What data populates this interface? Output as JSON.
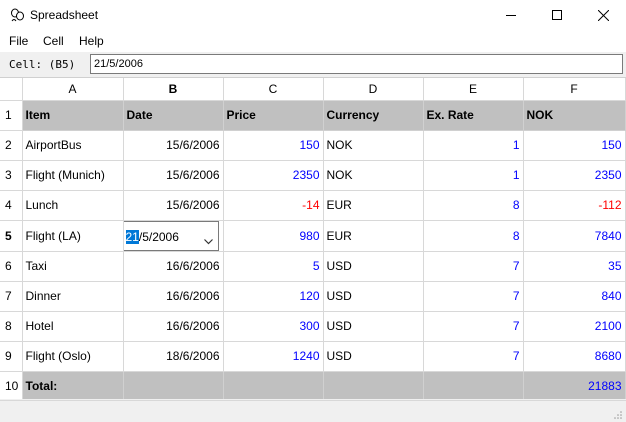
{
  "window": {
    "title": "Spreadsheet"
  },
  "menu": [
    "File",
    "Cell",
    "Help"
  ],
  "formula": {
    "cell_label": "Cell: (B5)",
    "value": "21/5/2006"
  },
  "columns": [
    "A",
    "B",
    "C",
    "D",
    "E",
    "F"
  ],
  "current_column": "B",
  "current_row": "5",
  "header": [
    "Item",
    "Date",
    "Price",
    "Currency",
    "Ex. Rate",
    "NOK"
  ],
  "rows": [
    {
      "row": "2",
      "item": "AirportBus",
      "date": "15/6/2006",
      "price": "150",
      "currency": "NOK",
      "rate": "1",
      "nok": "150"
    },
    {
      "row": "3",
      "item": "Flight (Munich)",
      "date": "15/6/2006",
      "price": "2350",
      "currency": "NOK",
      "rate": "1",
      "nok": "2350"
    },
    {
      "row": "4",
      "item": "Lunch",
      "date": "15/6/2006",
      "price": "-14",
      "currency": "EUR",
      "rate": "8",
      "nok": "-112"
    },
    {
      "row": "5",
      "item": "Flight (LA)",
      "date": "21/5/2006",
      "price": "980",
      "currency": "EUR",
      "rate": "8",
      "nok": "7840"
    },
    {
      "row": "6",
      "item": "Taxi",
      "date": "16/6/2006",
      "price": "5",
      "currency": "USD",
      "rate": "7",
      "nok": "35"
    },
    {
      "row": "7",
      "item": "Dinner",
      "date": "16/6/2006",
      "price": "120",
      "currency": "USD",
      "rate": "7",
      "nok": "840"
    },
    {
      "row": "8",
      "item": "Hotel",
      "date": "16/6/2006",
      "price": "300",
      "currency": "USD",
      "rate": "7",
      "nok": "2100"
    },
    {
      "row": "9",
      "item": "Flight (Oslo)",
      "date": "18/6/2006",
      "price": "1240",
      "currency": "USD",
      "rate": "7",
      "nok": "8680"
    }
  ],
  "editor": {
    "selected": "21",
    "rest": "/5/2006"
  },
  "total": {
    "row": "10",
    "label": "Total:",
    "nok": "21883"
  },
  "colors": {
    "header_bg": "#c0c0c0",
    "number": "#0000ff",
    "negative": "#ff0000",
    "selection": "#0078d7"
  }
}
